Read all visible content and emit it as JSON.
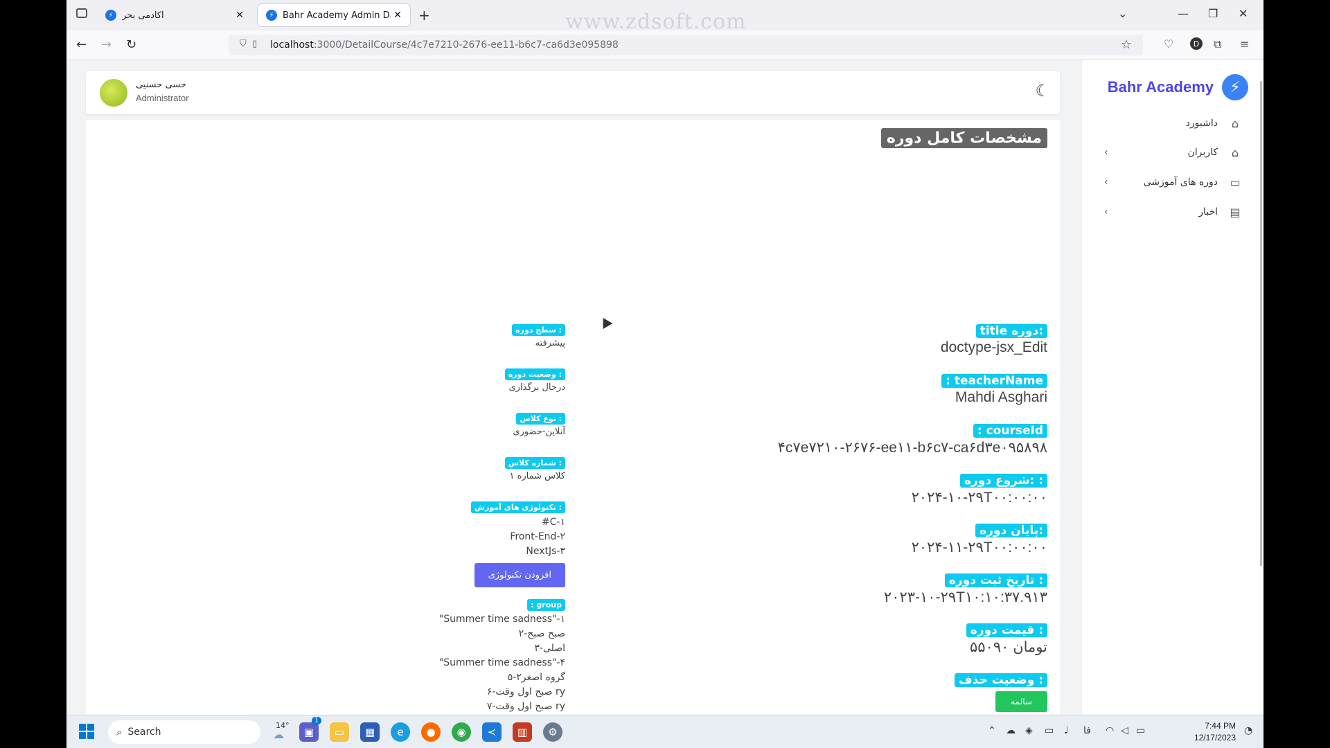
{
  "browser": {
    "tabs": [
      {
        "title": "آکادمی بحر"
      },
      {
        "title": "Bahr Academy Admin Dashboa"
      }
    ],
    "new_tab": "+",
    "url_host": "localhost",
    "url_path": ":3000/DetailCourse/4c7e7210-2676-ee11-b6c7-ca6d3e095898",
    "watermark": "www.zdsoft.com",
    "profile_initial": "D"
  },
  "sidebar": {
    "brand": "Bahr Academy",
    "items": [
      {
        "label": "داشبورد",
        "icon": "home-icon",
        "expandable": false
      },
      {
        "label": "کاربران",
        "icon": "home-icon",
        "expandable": true
      },
      {
        "label": "دوره های آموزشی",
        "icon": "monitor-icon",
        "expandable": true
      },
      {
        "label": "اخبار",
        "icon": "document-icon",
        "expandable": true
      }
    ]
  },
  "header": {
    "user_name": "حسی حسنیی",
    "user_role": "Administrator"
  },
  "page": {
    "title": "مشخصات کامل دوره"
  },
  "details_right": [
    {
      "label": "title دوره:",
      "value": "doctype-jsx_Edit"
    },
    {
      "label": ": teacherName",
      "value": "Mahdi Asghari"
    },
    {
      "label": ": courseId",
      "value": "۴c۷e۷۲۱۰-۲۶۷۶-ee۱۱-b۶c۷-ca۶d۳e۰۹۵۸۹۸"
    },
    {
      "label": "شروع دوره: :",
      "value": "۲۰۲۴-۱۰-۲۹T۰۰:۰۰:۰۰"
    },
    {
      "label": "پایان دوره:",
      "value": "۲۰۲۴-۱۱-۲۹T۰۰:۰۰:۰۰"
    },
    {
      "label": "تاریخ ثبت دوره :",
      "value": "۲۰۲۳-۱۰-۲۹T۱۰:۱۰:۳۷.۹۱۳"
    },
    {
      "label": "قیمت دوره :",
      "value": "۵۵۰۹۰ تومان"
    }
  ],
  "delete_status": {
    "label": "وضعیت حذف :",
    "button": "سالمه"
  },
  "details_left": [
    {
      "label": "سطح دوره :",
      "value": "پیشرفته"
    },
    {
      "label": "وضعیت دوره :",
      "value": "درحال برگذاری"
    },
    {
      "label": "نوع کلاس :",
      "value": "آنلاین-حضوری"
    },
    {
      "label": "شماره کلاس :",
      "value": "کلاس شماره ۱"
    }
  ],
  "technologies": {
    "label": "تکنولوژی های آموزش :",
    "items": [
      "#C-۱",
      "Front-End-۲",
      "NextJs-۳"
    ],
    "add_button": "افزودن تکنولوژی"
  },
  "groups": {
    "label": ": group",
    "items": [
      "\"Summer time sadness\"-۱",
      "۲-صبح صبح",
      "۳-اصلی",
      "\"Summer time sadness\"-۴",
      "۵-گروه اصغر۲",
      "۶-صبح اول وقت ry",
      "۷-صبح اول وقت ry"
    ]
  },
  "taskbar": {
    "search_placeholder": "Search",
    "weather": "14°",
    "chat_badge": "1",
    "lang": "فا",
    "time": "7:44 PM",
    "date": "12/17/2023"
  },
  "colors": {
    "accent": "#0dcaf0",
    "brand": "#4f46e5",
    "add_button": "#6366f1",
    "status_ok": "#22c55e"
  }
}
